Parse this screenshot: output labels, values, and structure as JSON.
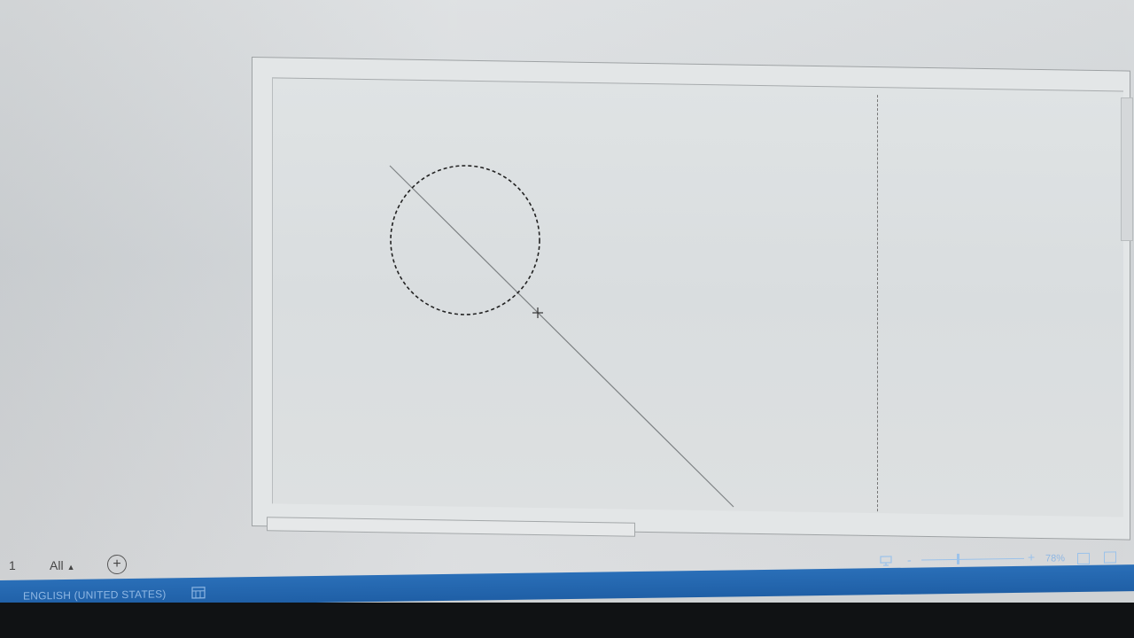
{
  "canvas": {
    "shapes": [
      "dashed-circle",
      "diagonal-line",
      "crosshair-cursor"
    ]
  },
  "sheet_tabs": {
    "page_number": "1",
    "active_tab": "All",
    "add_sheet_icon": "plus-circle-icon"
  },
  "statusbar": {
    "language": "ENGLISH (UNITED STATES)",
    "macro_icon": "macro-recording-icon",
    "zoom_minus": "-",
    "zoom_plus": "+",
    "zoom_level": "78%",
    "colors": {
      "statusbar_bg": "#2163ad",
      "statusbar_text": "#8fb7e3"
    }
  }
}
